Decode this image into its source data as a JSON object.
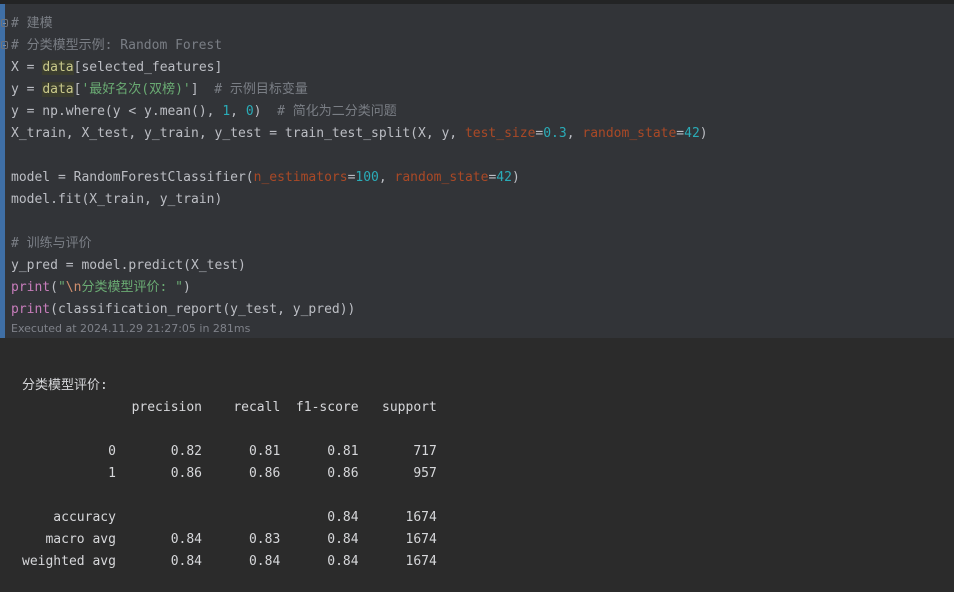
{
  "code_lines": [
    [
      {
        "t": "# 建模",
        "c": "cm"
      }
    ],
    [
      {
        "t": "# 分类模型示例: Random Forest",
        "c": "cm"
      }
    ],
    [
      {
        "t": "X = ",
        "c": ""
      },
      {
        "t": "data",
        "c": "var-hl"
      },
      {
        "t": "[selected_features]",
        "c": ""
      }
    ],
    [
      {
        "t": "y = ",
        "c": ""
      },
      {
        "t": "data",
        "c": "var-hl"
      },
      {
        "t": "[",
        "c": ""
      },
      {
        "t": "'最好名次(双榜)'",
        "c": "str"
      },
      {
        "t": "]  ",
        "c": ""
      },
      {
        "t": "# 示例目标变量",
        "c": "cm"
      }
    ],
    [
      {
        "t": "y = np.where(y < y.mean(), ",
        "c": ""
      },
      {
        "t": "1",
        "c": "num"
      },
      {
        "t": ", ",
        "c": ""
      },
      {
        "t": "0",
        "c": "num"
      },
      {
        "t": ")  ",
        "c": ""
      },
      {
        "t": "# 简化为二分类问题",
        "c": "cm"
      }
    ],
    [
      {
        "t": "X_train, X_test, y_train, y_test = train_test_split(X, y, ",
        "c": ""
      },
      {
        "t": "test_size",
        "c": "param"
      },
      {
        "t": "=",
        "c": ""
      },
      {
        "t": "0.3",
        "c": "num"
      },
      {
        "t": ", ",
        "c": ""
      },
      {
        "t": "random_state",
        "c": "param"
      },
      {
        "t": "=",
        "c": ""
      },
      {
        "t": "42",
        "c": "num"
      },
      {
        "t": ")",
        "c": ""
      }
    ],
    [],
    [
      {
        "t": "model = RandomForestClassifier(",
        "c": ""
      },
      {
        "t": "n_estimators",
        "c": "param"
      },
      {
        "t": "=",
        "c": ""
      },
      {
        "t": "100",
        "c": "num"
      },
      {
        "t": ", ",
        "c": ""
      },
      {
        "t": "random_state",
        "c": "param"
      },
      {
        "t": "=",
        "c": ""
      },
      {
        "t": "42",
        "c": "num"
      },
      {
        "t": ")",
        "c": ""
      }
    ],
    [
      {
        "t": "model.fit(X_train, y_train)",
        "c": ""
      }
    ],
    [],
    [
      {
        "t": "# 训练与评价",
        "c": "cm"
      }
    ],
    [
      {
        "t": "y_pred = model.predict(X_test)",
        "c": ""
      }
    ],
    [
      {
        "t": "print",
        "c": "kw"
      },
      {
        "t": "(",
        "c": ""
      },
      {
        "t": "\"",
        "c": "str"
      },
      {
        "t": "\\n",
        "c": "esc"
      },
      {
        "t": "分类模型评价: \"",
        "c": "str"
      },
      {
        "t": ")",
        "c": ""
      }
    ],
    [
      {
        "t": "print",
        "c": "kw"
      },
      {
        "t": "(classification_report(y_test, y_pred))",
        "c": ""
      }
    ]
  ],
  "execution_status": "Executed at 2024.11.29 21:27:05 in 281ms",
  "output_lines": [
    "分类模型评价:",
    "              precision    recall  f1-score   support",
    "",
    "           0       0.82      0.81      0.81       717",
    "           1       0.86      0.86      0.86       957",
    "",
    "    accuracy                           0.84      1674",
    "   macro avg       0.84      0.83      0.84      1674",
    "weighted avg       0.84      0.84      0.84      1674"
  ]
}
